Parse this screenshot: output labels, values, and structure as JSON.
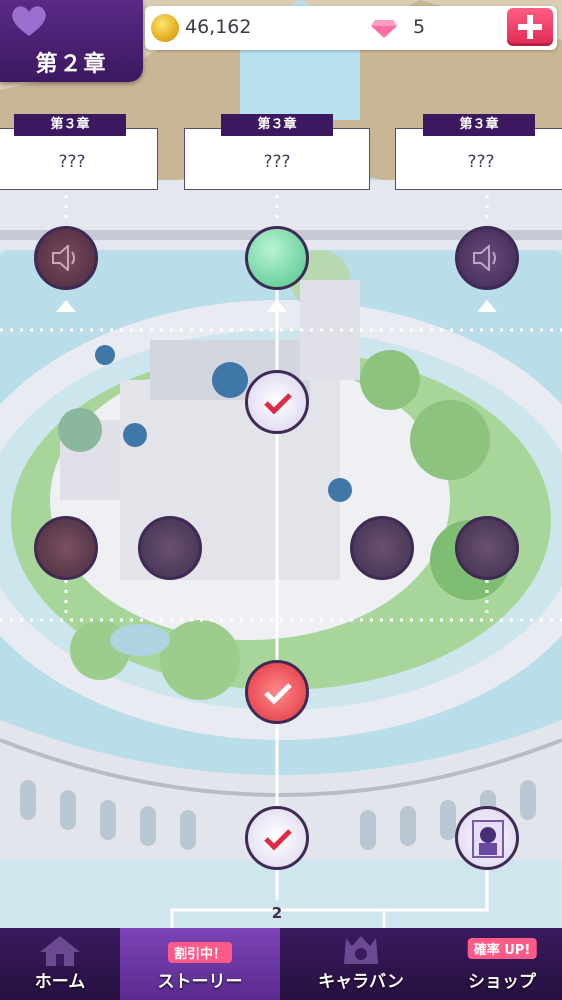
{
  "chapter_badge": {
    "title": "第２章"
  },
  "currency": {
    "gold": "46,162",
    "gems": "5",
    "gold_icon": "coin-icon",
    "gem_icon": "gem-icon",
    "add_icon": "plus-icon"
  },
  "chapter_cards": [
    {
      "tab": "第３章",
      "title": "???"
    },
    {
      "tab": "第３章",
      "title": "???"
    },
    {
      "tab": "第３章",
      "title": "???"
    }
  ],
  "map": {
    "page_number": "2"
  },
  "nav": {
    "home": {
      "label": "ホーム"
    },
    "story": {
      "label": "ストーリー",
      "badge": "割引中！"
    },
    "caravan": {
      "label": "キャラバン"
    },
    "shop": {
      "label": "ショップ",
      "badge": "確率 UP!"
    }
  },
  "colors": {
    "accent": "#3b1860",
    "pink": "#ff5d82",
    "node_border": "#3e2a55"
  }
}
